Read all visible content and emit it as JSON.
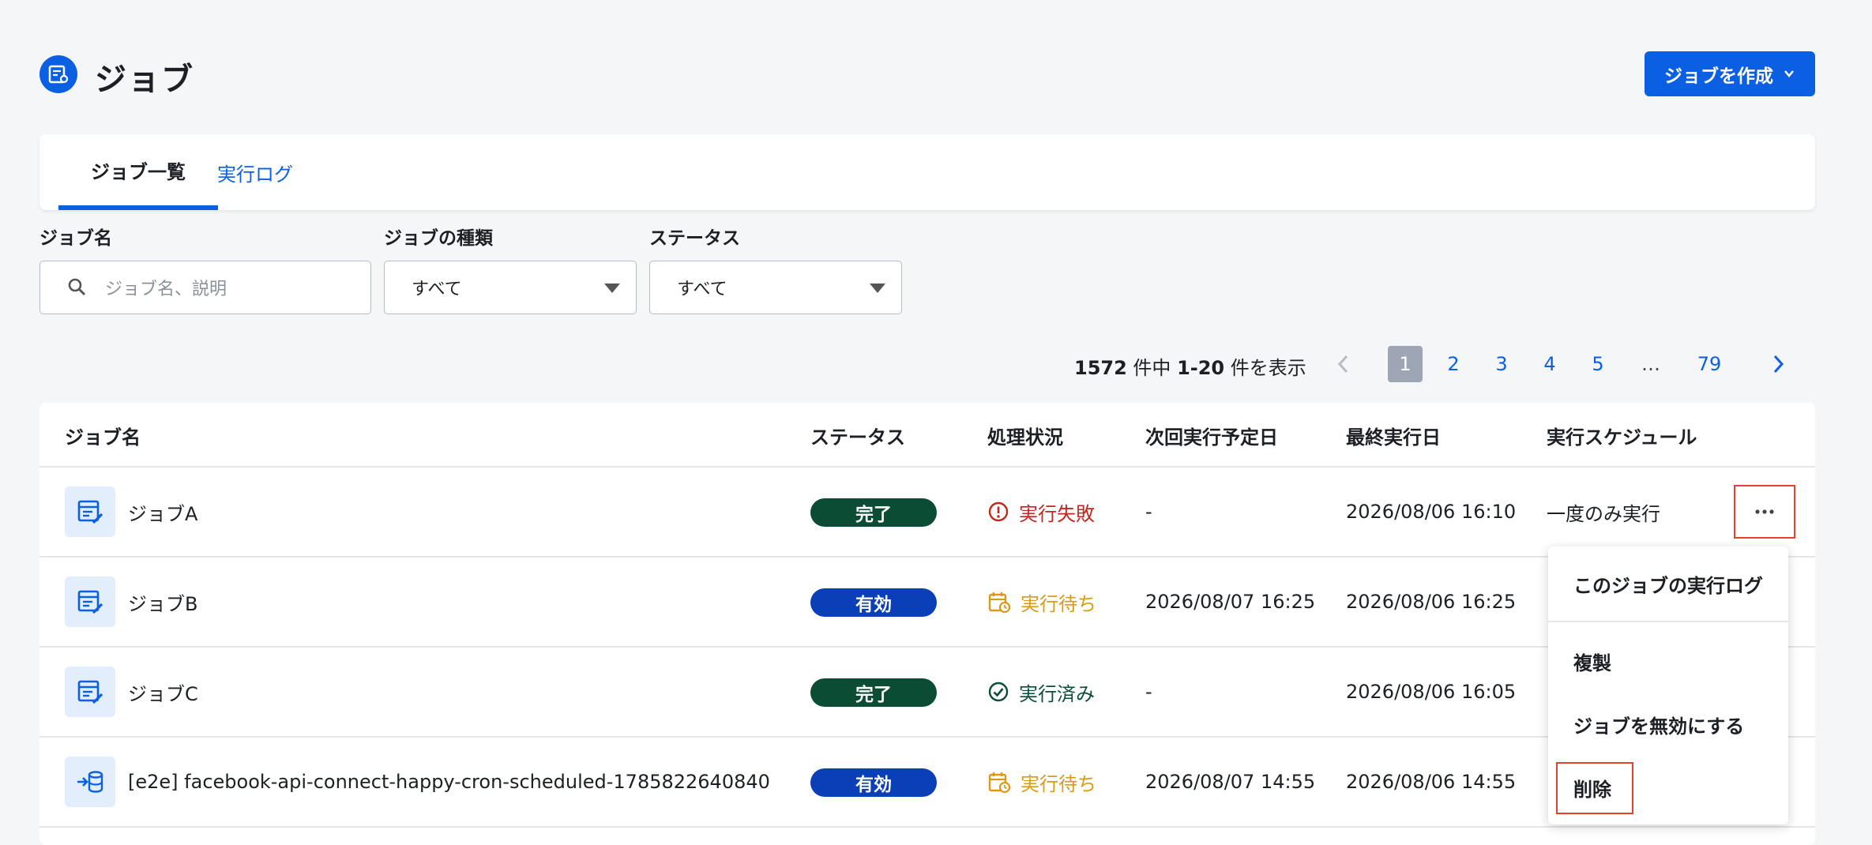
{
  "header": {
    "title": "ジョブ",
    "create_button": "ジョブを作成"
  },
  "tabs": [
    {
      "label": "ジョブ一覧",
      "active": true
    },
    {
      "label": "実行ログ",
      "active": false
    }
  ],
  "filters": {
    "job_name": {
      "label": "ジョブ名",
      "placeholder": "ジョブ名、説明"
    },
    "job_type": {
      "label": "ジョブの種類",
      "value": "すべて"
    },
    "status": {
      "label": "ステータス",
      "value": "すべて"
    }
  },
  "pagination": {
    "total": "1572",
    "total_unit": " 件中 ",
    "range": "1-20",
    "range_unit": " 件を表示",
    "pages": [
      "1",
      "2",
      "3",
      "4",
      "5",
      "…",
      "79"
    ],
    "current": "1"
  },
  "table": {
    "columns": [
      "ジョブ名",
      "ステータス",
      "処理状況",
      "次回実行予定日",
      "最終実行日",
      "実行スケジュール"
    ],
    "rows": [
      {
        "name": "ジョブA",
        "icon": "table-edit-icon",
        "status": "完了",
        "process": "実行失敗",
        "process_icon": "error-circle-icon",
        "next_run": "-",
        "last_run": "2026/08/06 16:10",
        "schedule": "一度のみ実行"
      },
      {
        "name": "ジョブB",
        "icon": "table-edit-icon",
        "status": "有効",
        "process": "実行待ち",
        "process_icon": "calendar-clock-icon",
        "next_run": "2026/08/07 16:25",
        "last_run": "2026/08/06 16:25",
        "schedule": ""
      },
      {
        "name": "ジョブC",
        "icon": "table-edit-icon",
        "status": "完了",
        "process": "実行済み",
        "process_icon": "check-circle-icon",
        "next_run": "-",
        "last_run": "2026/08/06 16:05",
        "schedule": ""
      },
      {
        "name": "[e2e] facebook-api-connect-happy-cron-scheduled-1785822640840",
        "icon": "import-database-icon",
        "status": "有効",
        "process": "実行待ち",
        "process_icon": "calendar-clock-icon",
        "next_run": "2026/08/07 14:55",
        "last_run": "2026/08/06 14:55",
        "schedule": ""
      }
    ]
  },
  "row_menu": {
    "items": [
      "このジョブの実行ログ",
      "複製",
      "ジョブを無効にする",
      "削除"
    ]
  },
  "colors": {
    "primary": "#0b5fe3",
    "badge_done": "#0b4d34",
    "badge_active": "#0a3fb8",
    "status_failed": "#c0271f",
    "status_waiting": "#d99a16",
    "status_executed": "#0b4d34",
    "highlight": "#e5412d"
  }
}
